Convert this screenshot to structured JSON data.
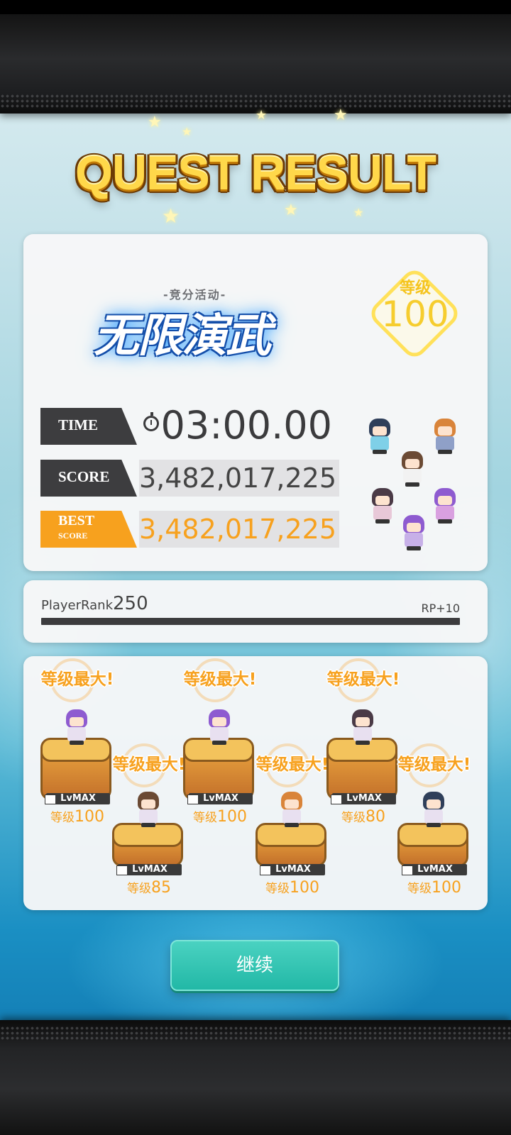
{
  "header": {
    "title": "QUEST RESULT"
  },
  "event": {
    "subtitle": "-竞分活动-",
    "name": "无限演武"
  },
  "rank_badge": {
    "label": "等级",
    "value": "100"
  },
  "results": {
    "time_label": "TIME",
    "time_value": "03:00.00",
    "score_label": "SCORE",
    "score_value": "3,482,017,225",
    "best_label": "BEST",
    "best_sub": "SCORE",
    "best_value": "3,482,017,225"
  },
  "player": {
    "rank_label": "PlayerRank",
    "rank_value": "250",
    "rp": "RP+10",
    "progress": 1.0
  },
  "units": [
    {
      "max_label": "等级最大!",
      "lv_tag": "LvMAX",
      "level_label": "等级",
      "level": "100",
      "hair": "#8e5bd0"
    },
    {
      "max_label": "等级最大!",
      "lv_tag": "LvMAX",
      "level_label": "等级",
      "level": "85",
      "hair": "#6b4a34"
    },
    {
      "max_label": "等级最大!",
      "lv_tag": "LvMAX",
      "level_label": "等级",
      "level": "100",
      "hair": "#8e5bd0"
    },
    {
      "max_label": "等级最大!",
      "lv_tag": "LvMAX",
      "level_label": "等级",
      "level": "100",
      "hair": "#d9843a"
    },
    {
      "max_label": "等级最大!",
      "lv_tag": "LvMAX",
      "level_label": "等级",
      "level": "80",
      "hair": "#4a3a46"
    },
    {
      "max_label": "等级最大!",
      "lv_tag": "LvMAX",
      "level_label": "等级",
      "level": "100",
      "hair": "#2f3f5a"
    }
  ],
  "actions": {
    "continue_label": "继续"
  },
  "colors": {
    "accent": "#f7a11e",
    "button": "#2cc3b0",
    "title_gold": "#ffd84a"
  }
}
